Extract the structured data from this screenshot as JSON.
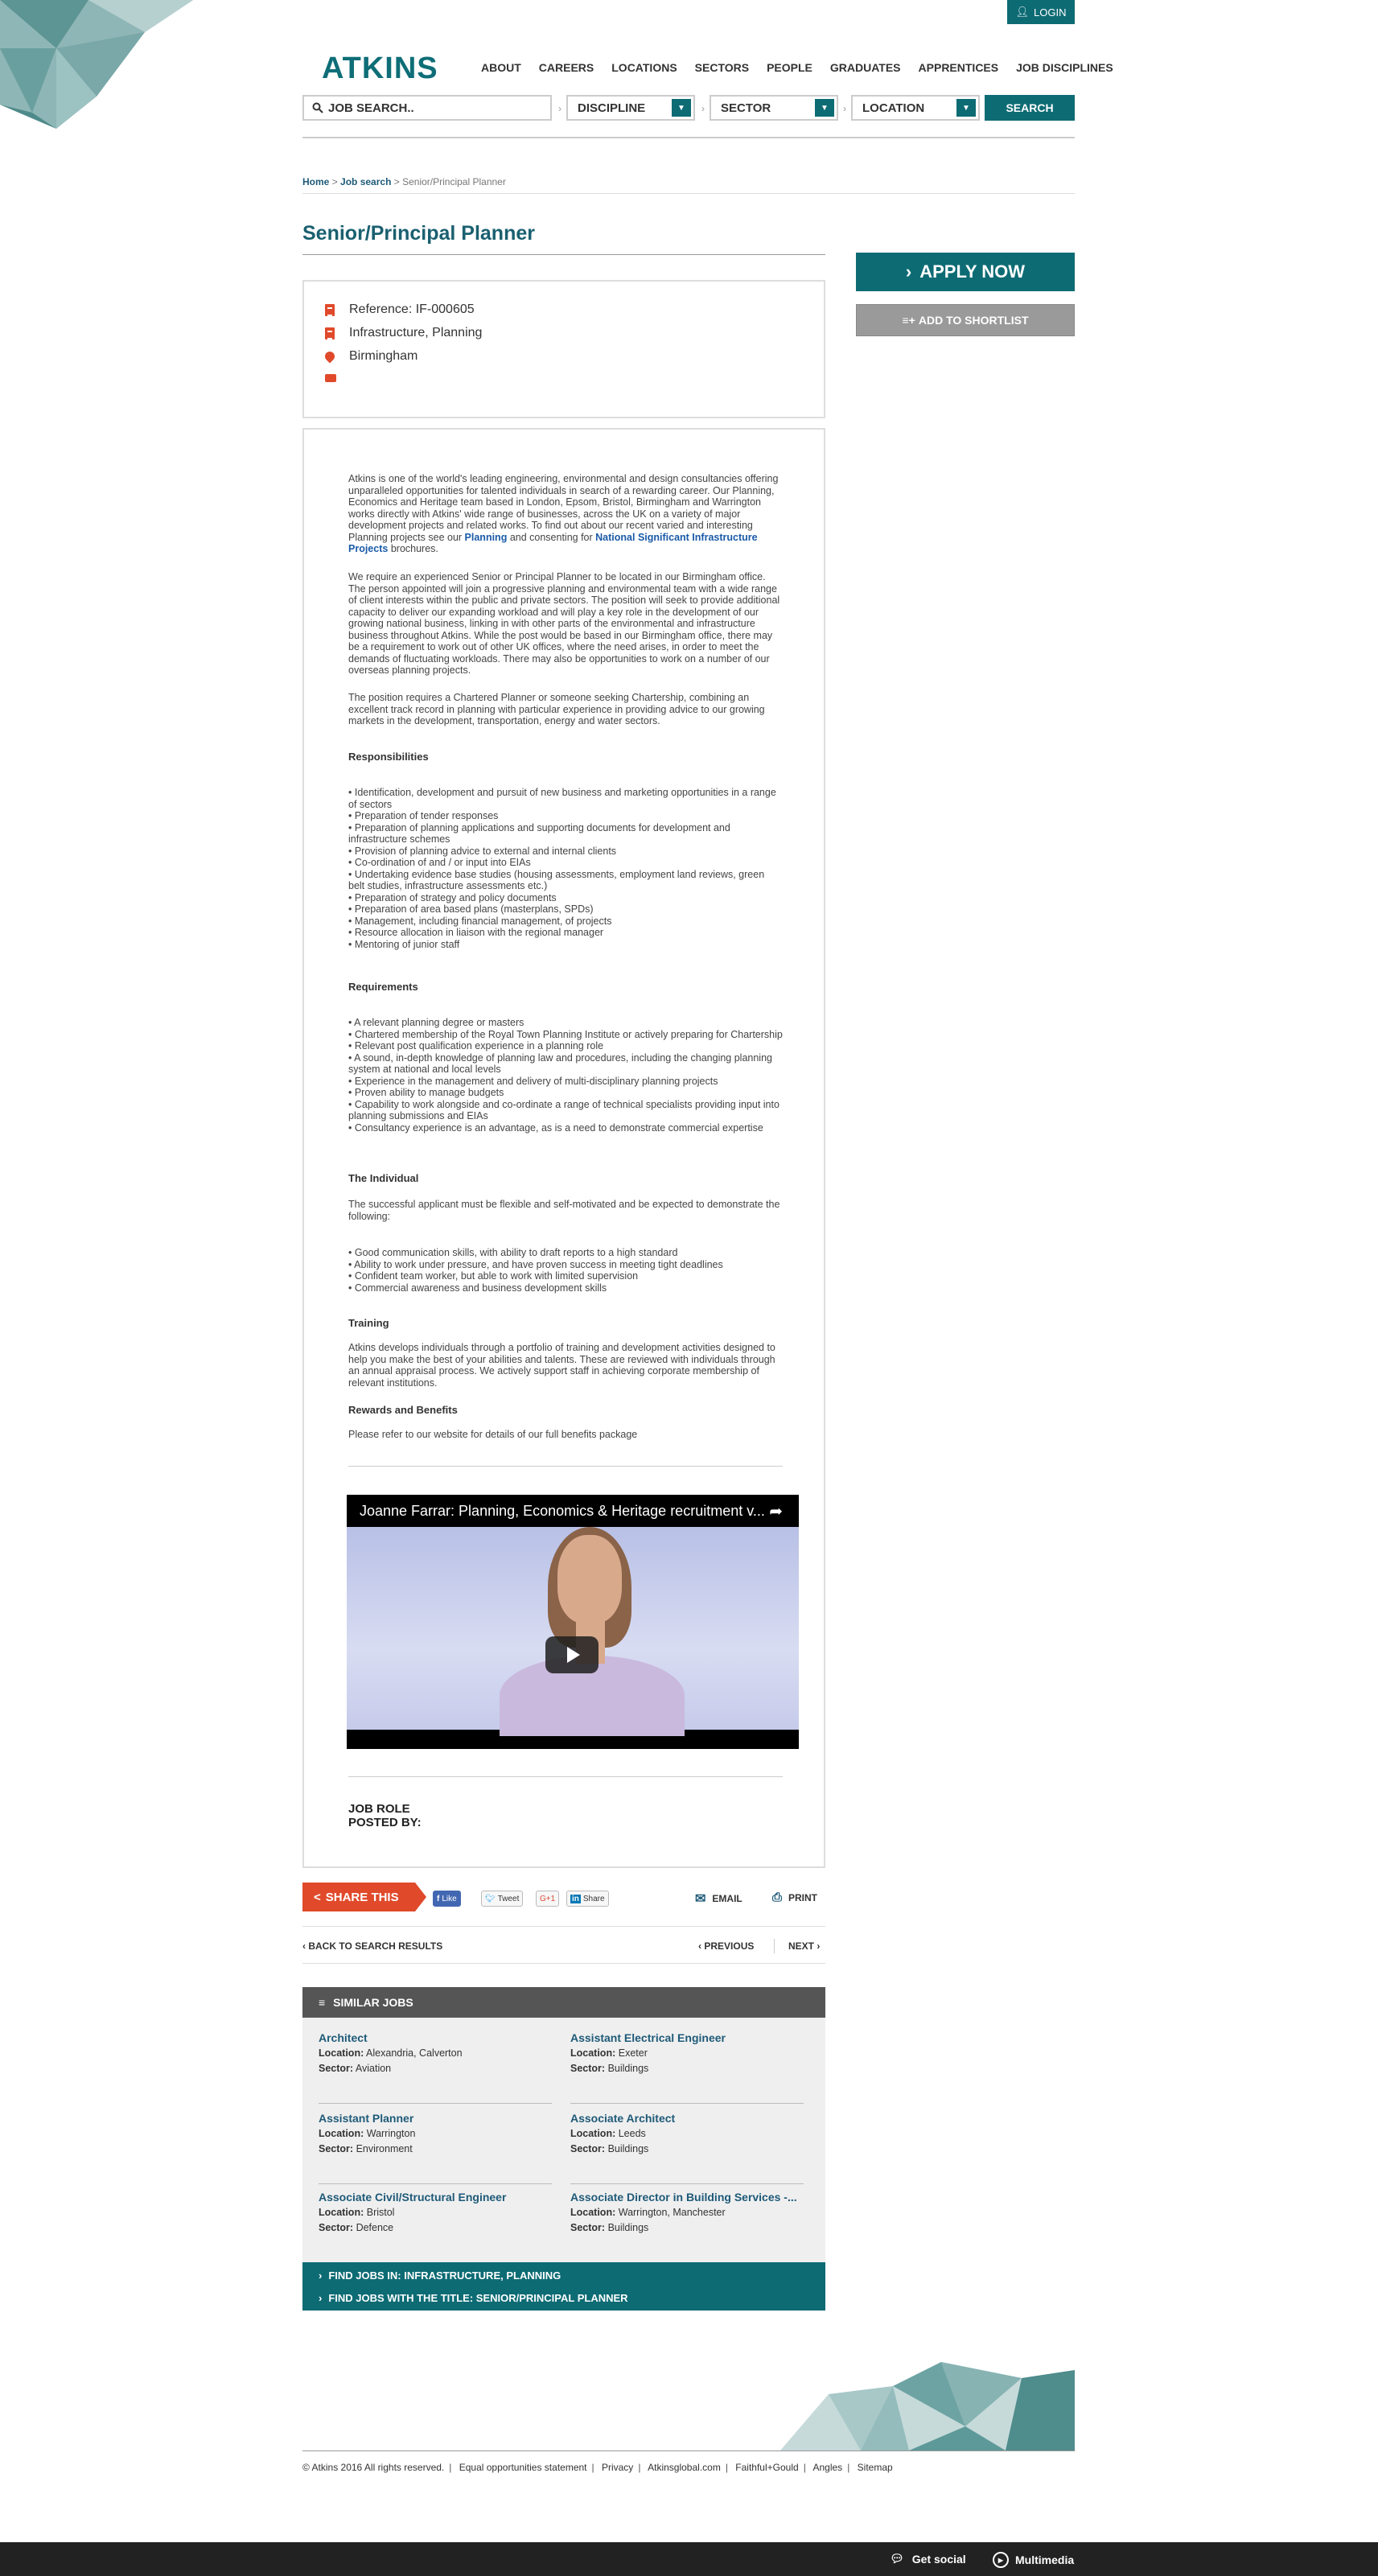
{
  "header": {
    "login_label": "LOGIN",
    "logo_text": "ATKINS",
    "nav": [
      "ABOUT",
      "CAREERS",
      "LOCATIONS",
      "SECTORS",
      "PEOPLE",
      "GRADUATES",
      "APPRENTICES",
      "JOB DISCIPLINES"
    ],
    "search_placeholder": "JOB SEARCH..",
    "discipline_label": "DISCIPLINE",
    "sector_label": "SECTOR",
    "location_label": "LOCATION",
    "search_button": "SEARCH"
  },
  "breadcrumb": {
    "home": "Home",
    "job_search": "Job search",
    "current": "Senior/Principal Planner"
  },
  "job": {
    "title": "Senior/Principal Planner",
    "reference": "Reference: IF-000605",
    "discipline": "Infrastructure, Planning",
    "location": "Birmingham"
  },
  "actions": {
    "apply": "APPLY NOW",
    "shortlist": "ADD TO SHORTLIST"
  },
  "description": {
    "intro_1": "Atkins is one of the world's leading engineering, environmental and design consultancies offering unparalleled opportunities for talented individuals in search of a rewarding career. Our Planning, Economics and Heritage team based in London, Epsom, Bristol, Birmingham and Warrington works directly with Atkins' wide range of businesses, across the UK on a variety of major development projects and related works. To find out about our recent varied and interesting Planning projects see our",
    "link_planning": "Planning",
    "intro_and": "and consenting for",
    "link_nsip": "National Significant Infrastructure Projects",
    "intro_end": "brochures.",
    "para_2": "We require an experienced Senior or Principal Planner to be located in our Birmingham office. The person appointed will join a progressive planning and environmental team with a wide range of client interests within the public and private sectors. The position will seek to provide additional capacity to deliver our expanding workload and will play a key role in the development of our growing national business, linking in with other parts of the environmental and infrastructure business throughout Atkins. While the post would be based in our Birmingham office, there may be a requirement to work out of other UK offices, where the need arises, in order to meet the demands of fluctuating workloads. There may also be opportunities to work on a number of our overseas planning projects.",
    "para_3": "The position requires a Chartered Planner or someone seeking Chartership, combining an excellent track record in planning with particular experience in providing advice to our growing markets in the development, transportation, energy and water sectors.",
    "responsibilities_heading": "Responsibilities",
    "responsibilities": [
      "• Identification, development and pursuit of new business and marketing opportunities in a range of sectors",
      "• Preparation of tender responses",
      "• Preparation of planning applications and supporting documents for development and infrastructure schemes",
      "• Provision of planning advice to external and internal clients",
      "• Co-ordination of and / or input into EIAs",
      "• Undertaking evidence base studies (housing assessments, employment land reviews, green belt studies, infrastructure assessments etc.)",
      "• Preparation of strategy and policy documents",
      "• Preparation of area based plans (masterplans, SPDs)",
      "• Management, including financial management, of projects",
      "• Resource allocation in liaison with the regional manager",
      "• Mentoring of junior staff"
    ],
    "requirements_heading": "Requirements",
    "requirements": [
      "• A relevant planning degree or masters",
      "• Chartered membership of the Royal Town Planning Institute or actively preparing for Chartership",
      "• Relevant post qualification experience in a planning role",
      "• A sound, in-depth knowledge of planning law and procedures, including the changing planning system at national and local levels",
      "• Experience in the management and delivery of multi-disciplinary planning projects",
      "• Proven ability to manage budgets",
      "• Capability to work alongside and co-ordinate a range of technical specialists providing input into planning submissions and EIAs",
      "• Consultancy experience is an advantage, as is a need to demonstrate commercial expertise"
    ],
    "individual_heading": "The Individual",
    "individual_intro": "The successful applicant must be flexible and self-motivated and be expected to demonstrate the following:",
    "individual": [
      "• Good communication skills, with ability to draft reports to a high standard",
      "• Ability to work under pressure, and have proven success in meeting tight deadlines",
      "• Confident team worker, but able to work with limited supervision",
      "• Commercial awareness and business development skills"
    ],
    "training_heading": "Training",
    "training": "Atkins develops individuals through a portfolio of training and development activities designed to help you make the best of your abilities and talents. These are reviewed with individuals through an annual appraisal process. We actively support staff in achieving corporate membership of relevant institutions.",
    "rewards_heading": "Rewards and Benefits",
    "rewards": "Please refer to our website for details of our full benefits package",
    "video_title": "Joanne Farrar: Planning, Economics & Heritage recruitment v...",
    "job_role_label": "JOB ROLE",
    "posted_by_label": "POSTED BY:"
  },
  "share": {
    "share_label": "SHARE THIS",
    "like": "Like",
    "tweet": "Tweet",
    "gplus": "G+1",
    "linkedin": "Share",
    "email": "EMAIL",
    "print": "PRINT"
  },
  "pager": {
    "back": "BACK TO SEARCH RESULTS",
    "previous": "PREVIOUS",
    "next": "NEXT"
  },
  "similar": {
    "heading": "SIMILAR JOBS",
    "location_label": "Location:",
    "sector_label": "Sector:",
    "jobs": [
      {
        "title": "Architect",
        "location": "Alexandria, Calverton",
        "sector": "Aviation"
      },
      {
        "title": "Assistant Electrical Engineer",
        "location": "Exeter",
        "sector": "Buildings"
      },
      {
        "title": "Assistant Planner",
        "location": "Warrington",
        "sector": "Environment"
      },
      {
        "title": "Associate Architect",
        "location": "Leeds",
        "sector": "Buildings"
      },
      {
        "title": "Associate Civil/Structural Engineer",
        "location": "Bristol",
        "sector": "Defence"
      },
      {
        "title": "Associate Director in Building Services -...",
        "location": "Warrington, Manchester",
        "sector": "Buildings"
      }
    ],
    "find_1": "FIND JOBS IN: INFRASTRUCTURE, PLANNING",
    "find_2": "FIND JOBS WITH THE TITLE: SENIOR/PRINCIPAL PLANNER"
  },
  "footer": {
    "copyright": "© Atkins 2016 All rights reserved.",
    "links": [
      "Equal opportunities statement",
      "Privacy",
      "Atkinsglobal.com",
      "Faithful+Gould",
      "Angles",
      "Sitemap"
    ],
    "get_social": "Get social",
    "multimedia": "Multimedia"
  },
  "colors": {
    "brand_teal": "#0d6b74",
    "accent_orange": "#e04a2b",
    "link_blue": "#1a5aa8"
  }
}
